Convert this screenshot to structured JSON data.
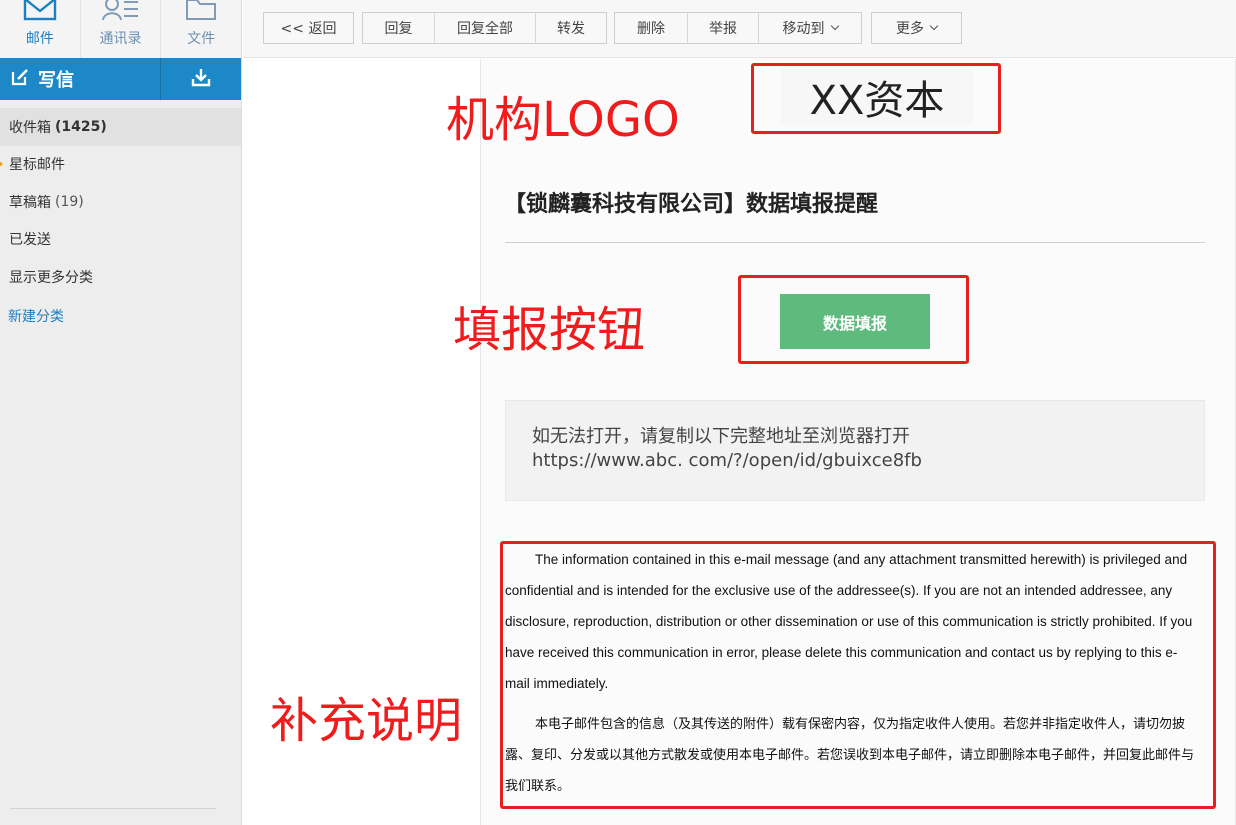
{
  "nav": {
    "tabs": [
      {
        "label": "邮件",
        "icon": "mail-icon"
      },
      {
        "label": "通讯录",
        "icon": "contacts-icon"
      },
      {
        "label": "文件",
        "icon": "folder-icon"
      }
    ],
    "write_label": "写信",
    "download_icon": "download-icon"
  },
  "folders": {
    "inbox": {
      "label": "收件箱",
      "count": "(1425)"
    },
    "starred": {
      "label": "星标邮件"
    },
    "drafts": {
      "label": "草稿箱",
      "count": "(19)"
    },
    "sent": {
      "label": "已发送"
    },
    "more": {
      "label": "显示更多分类"
    },
    "new_folder": "新建分类"
  },
  "toolbar": {
    "back": "<< 返回",
    "reply": "回复",
    "reply_all": "回复全部",
    "forward": "转发",
    "delete": "删除",
    "report": "举报",
    "move_to": "移动到",
    "more": "更多"
  },
  "annotations": {
    "logo": "机构LOGO",
    "button": "填报按钮",
    "note": "补充说明"
  },
  "mail": {
    "logo_text": "XX资本",
    "title": "【锁麟囊科技有限公司】数据填报提醒",
    "fill_button": "数据填报",
    "notice_line1": "如无法打开，请复制以下完整地址至浏览器打开",
    "notice_url": "https://www.abc. com/?/open/id/gbuixce8fb",
    "disclaimer_en": "The information contained in this e-mail message (and any attachment transmitted herewith) is privileged and confidential and is intended for the exclusive use of the addressee(s). If you are not an intended addressee, any disclosure, reproduction, distribution or other dissemination or use of this communication is strictly prohibited. If you have received this communication in error, please delete this communication and contact us by replying to this e-mail immediately.",
    "disclaimer_cn": "本电子邮件包含的信息（及其传送的附件）载有保密内容，仅为指定收件人使用。若您并非指定收件人，请切勿披露、复印、分发或以其他方式散发或使用本电子邮件。若您误收到本电子邮件，请立即删除本电子邮件，并回复此邮件与我们联系。"
  },
  "colors": {
    "accent": "#1d88c7",
    "annotation_red": "#e8201d",
    "fill_button": "#5fba7d"
  }
}
